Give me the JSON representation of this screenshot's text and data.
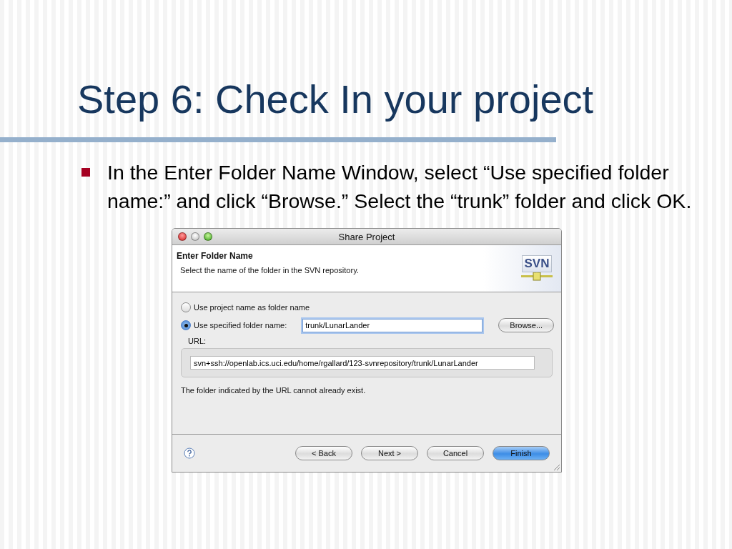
{
  "slide": {
    "title": "Step 6: Check In your project",
    "bullets": [
      {
        "text": "In the Enter Folder Name Window, select “Use specified folder name:” and click “Browse.” Select the “trunk” folder and click OK."
      }
    ]
  },
  "dialog": {
    "title": "Share Project",
    "header": {
      "title": "Enter Folder Name",
      "description": "Select the name of the folder in the SVN repository.",
      "logo": "SVN"
    },
    "options": [
      {
        "label": "Use project name as folder name",
        "selected": false
      },
      {
        "label": "Use specified folder name:",
        "selected": true
      }
    ],
    "folder_field": {
      "value": "trunk/LunarLander"
    },
    "browse_button": "Browse...",
    "url_label": "URL:",
    "url_value": "svn+ssh://openlab.ics.uci.edu/home/rgallard/123-svnrepository/trunk/LunarLander",
    "note": "The folder indicated by the URL cannot already exist.",
    "buttons": [
      {
        "label": "< Back",
        "primary": false
      },
      {
        "label": "Next >",
        "primary": false
      },
      {
        "label": "Cancel",
        "primary": false
      },
      {
        "label": "Finish",
        "primary": true
      }
    ]
  }
}
